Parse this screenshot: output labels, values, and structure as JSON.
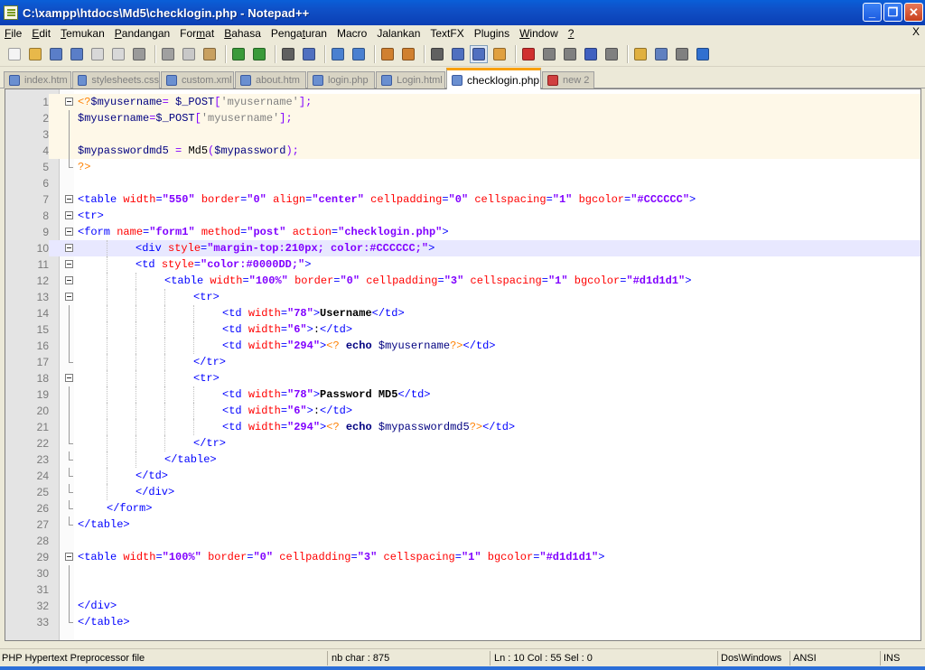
{
  "window": {
    "title": "C:\\xampp\\htdocs\\Md5\\checklogin.php - Notepad++"
  },
  "menu": [
    {
      "label": "File",
      "key": "F"
    },
    {
      "label": "Edit",
      "key": "E"
    },
    {
      "label": "Temukan",
      "key": "T"
    },
    {
      "label": "Pandangan",
      "key": "P"
    },
    {
      "label": "Format",
      "key": "m"
    },
    {
      "label": "Bahasa",
      "key": "B"
    },
    {
      "label": "Pengaturan",
      "key": "t"
    },
    {
      "label": "Macro",
      "key": ""
    },
    {
      "label": "Jalankan",
      "key": ""
    },
    {
      "label": "TextFX",
      "key": ""
    },
    {
      "label": "Plugins",
      "key": ""
    },
    {
      "label": "Window",
      "key": "W"
    },
    {
      "label": "?",
      "key": "?"
    }
  ],
  "menu_close": "X",
  "toolbar": [
    {
      "icon": "new-file-icon",
      "color": "#f4f4f4"
    },
    {
      "icon": "open-file-icon",
      "color": "#e8b84a"
    },
    {
      "icon": "save-icon",
      "color": "#5a7ec8"
    },
    {
      "icon": "save-all-icon",
      "color": "#5a7ec8"
    },
    {
      "icon": "close-file-icon",
      "color": "#d8d8d8"
    },
    {
      "icon": "close-all-icon",
      "color": "#d8d8d8"
    },
    {
      "icon": "print-icon",
      "color": "#9a9a9a"
    },
    {
      "sep": true
    },
    {
      "icon": "cut-icon",
      "color": "#a0a0a0"
    },
    {
      "icon": "copy-icon",
      "color": "#c8c8c8"
    },
    {
      "icon": "paste-icon",
      "color": "#c8a060"
    },
    {
      "sep": true
    },
    {
      "icon": "undo-icon",
      "color": "#3a9a3a"
    },
    {
      "icon": "redo-icon",
      "color": "#3a9a3a"
    },
    {
      "sep": true
    },
    {
      "icon": "find-icon",
      "color": "#606060"
    },
    {
      "icon": "replace-icon",
      "color": "#5070c0"
    },
    {
      "sep": true
    },
    {
      "icon": "zoom-in-icon",
      "color": "#4a80d0"
    },
    {
      "icon": "zoom-out-icon",
      "color": "#4a80d0"
    },
    {
      "sep": true
    },
    {
      "icon": "sync-vertical-icon",
      "color": "#d08030"
    },
    {
      "icon": "sync-horizontal-icon",
      "color": "#d08030"
    },
    {
      "sep": true
    },
    {
      "icon": "word-wrap-icon",
      "color": "#606060"
    },
    {
      "icon": "show-all-chars-icon",
      "color": "#5070c0"
    },
    {
      "icon": "indent-guide-icon",
      "color": "#5070c0",
      "active": true
    },
    {
      "icon": "user-language-icon",
      "color": "#e0a040"
    },
    {
      "sep": true
    },
    {
      "icon": "record-macro-icon",
      "color": "#d03030"
    },
    {
      "icon": "stop-macro-icon",
      "color": "#808080"
    },
    {
      "icon": "play-macro-icon",
      "color": "#808080"
    },
    {
      "icon": "run-macro-multiple-icon",
      "color": "#4060c0"
    },
    {
      "icon": "save-macro-icon",
      "color": "#808080"
    },
    {
      "sep": true
    },
    {
      "icon": "folder-icon",
      "color": "#e0b040"
    },
    {
      "icon": "window-icon",
      "color": "#6080c0"
    },
    {
      "icon": "print-preview-icon",
      "color": "#808080"
    },
    {
      "icon": "spellcheck-icon",
      "color": "#3070d0"
    }
  ],
  "tabs": [
    {
      "label": "index.htm",
      "active": false,
      "unsaved": false
    },
    {
      "label": "stylesheets.css",
      "active": false,
      "unsaved": false
    },
    {
      "label": "custom.xml",
      "active": false,
      "unsaved": false
    },
    {
      "label": "about.htm",
      "active": false,
      "unsaved": false
    },
    {
      "label": "login.php",
      "active": false,
      "unsaved": false
    },
    {
      "label": "Login.html",
      "active": false,
      "unsaved": false
    },
    {
      "label": "checklogin.php",
      "active": true,
      "unsaved": false
    },
    {
      "label": "new 2",
      "active": false,
      "unsaved": true
    }
  ],
  "current_line": 10,
  "code": [
    {
      "n": "1",
      "fold": "box",
      "php": true,
      "indent": 0,
      "tokens": [
        [
          "php",
          "<?"
        ],
        [
          "var",
          "$myusername"
        ],
        [
          "op",
          "= "
        ],
        [
          "var",
          "$_POST"
        ],
        [
          "op",
          "["
        ],
        [
          "str",
          "'myusername'"
        ],
        [
          "op",
          "];"
        ]
      ]
    },
    {
      "n": "2",
      "fold": "line",
      "php": true,
      "indent": 0,
      "tokens": [
        [
          "var",
          "$myusername"
        ],
        [
          "op",
          "="
        ],
        [
          "var",
          "$_POST"
        ],
        [
          "op",
          "["
        ],
        [
          "str",
          "'myusername'"
        ],
        [
          "op",
          "];"
        ]
      ]
    },
    {
      "n": "3",
      "fold": "line",
      "php": true,
      "indent": 0,
      "tokens": []
    },
    {
      "n": "4",
      "fold": "line",
      "php": true,
      "indent": 0,
      "tokens": [
        [
          "var",
          "$mypasswordmd5"
        ],
        [
          "op",
          " = "
        ],
        [
          "fn",
          "Md5"
        ],
        [
          "op",
          "("
        ],
        [
          "var",
          "$mypassword"
        ],
        [
          "op",
          ");"
        ]
      ]
    },
    {
      "n": "5",
      "fold": "end",
      "php": false,
      "indent": 0,
      "tokens": [
        [
          "php",
          "?>"
        ]
      ]
    },
    {
      "n": "6",
      "fold": "",
      "php": false,
      "indent": 0,
      "tokens": []
    },
    {
      "n": "7",
      "fold": "box",
      "php": false,
      "indent": 0,
      "tokens": [
        [
          "tag",
          "<table "
        ],
        [
          "attr",
          "width"
        ],
        [
          "tag",
          "="
        ],
        [
          "val",
          "\"550\""
        ],
        [
          "tag",
          " "
        ],
        [
          "attr",
          "border"
        ],
        [
          "tag",
          "="
        ],
        [
          "val",
          "\"0\""
        ],
        [
          "tag",
          " "
        ],
        [
          "attr",
          "align"
        ],
        [
          "tag",
          "="
        ],
        [
          "val",
          "\"center\""
        ],
        [
          "tag",
          " "
        ],
        [
          "attr",
          "cellpadding"
        ],
        [
          "tag",
          "="
        ],
        [
          "val",
          "\"0\""
        ],
        [
          "tag",
          " "
        ],
        [
          "attr",
          "cellspacing"
        ],
        [
          "tag",
          "="
        ],
        [
          "val",
          "\"1\""
        ],
        [
          "tag",
          " "
        ],
        [
          "attr",
          "bgcolor"
        ],
        [
          "tag",
          "="
        ],
        [
          "val",
          "\"#CCCCCC\""
        ],
        [
          "tag",
          ">"
        ]
      ]
    },
    {
      "n": "8",
      "fold": "box",
      "php": false,
      "indent": 0,
      "tokens": [
        [
          "tag",
          "<tr>"
        ]
      ]
    },
    {
      "n": "9",
      "fold": "box",
      "php": false,
      "indent": 0,
      "tokens": [
        [
          "tag",
          "<form "
        ],
        [
          "attr",
          "name"
        ],
        [
          "tag",
          "="
        ],
        [
          "val",
          "\"form1\""
        ],
        [
          "tag",
          " "
        ],
        [
          "attr",
          "method"
        ],
        [
          "tag",
          "="
        ],
        [
          "val",
          "\"post\""
        ],
        [
          "tag",
          " "
        ],
        [
          "attr",
          "action"
        ],
        [
          "tag",
          "="
        ],
        [
          "val",
          "\"checklogin.php\""
        ],
        [
          "tag",
          ">"
        ]
      ]
    },
    {
      "n": "10",
      "fold": "box",
      "php": false,
      "indent": 2,
      "tokens": [
        [
          "tag",
          "<div "
        ],
        [
          "attr",
          "style"
        ],
        [
          "tag",
          "="
        ],
        [
          "val",
          "\"margin-top:210px; color:#CCCCCC;\""
        ],
        [
          "tag",
          ">"
        ]
      ]
    },
    {
      "n": "11",
      "fold": "box",
      "php": false,
      "indent": 2,
      "tokens": [
        [
          "tag",
          "<td "
        ],
        [
          "attr",
          "style"
        ],
        [
          "tag",
          "="
        ],
        [
          "val",
          "\"color:#0000DD;\""
        ],
        [
          "tag",
          ">"
        ]
      ]
    },
    {
      "n": "12",
      "fold": "box",
      "php": false,
      "indent": 3,
      "tokens": [
        [
          "tag",
          "<table "
        ],
        [
          "attr",
          "width"
        ],
        [
          "tag",
          "="
        ],
        [
          "val",
          "\"100%\""
        ],
        [
          "tag",
          " "
        ],
        [
          "attr",
          "border"
        ],
        [
          "tag",
          "="
        ],
        [
          "val",
          "\"0\""
        ],
        [
          "tag",
          " "
        ],
        [
          "attr",
          "cellpadding"
        ],
        [
          "tag",
          "="
        ],
        [
          "val",
          "\"3\""
        ],
        [
          "tag",
          " "
        ],
        [
          "attr",
          "cellspacing"
        ],
        [
          "tag",
          "="
        ],
        [
          "val",
          "\"1\""
        ],
        [
          "tag",
          " "
        ],
        [
          "attr",
          "bgcolor"
        ],
        [
          "tag",
          "="
        ],
        [
          "val",
          "\"#d1d1d1\""
        ],
        [
          "tag",
          ">"
        ]
      ]
    },
    {
      "n": "13",
      "fold": "box",
      "php": false,
      "indent": 4,
      "tokens": [
        [
          "tag",
          "<tr>"
        ]
      ]
    },
    {
      "n": "14",
      "fold": "line",
      "php": false,
      "indent": 5,
      "tokens": [
        [
          "tag",
          "<td "
        ],
        [
          "attr",
          "width"
        ],
        [
          "tag",
          "="
        ],
        [
          "val",
          "\"78\""
        ],
        [
          "tag",
          ">"
        ],
        [
          "bold",
          "Username"
        ],
        [
          "tag",
          "</td>"
        ]
      ]
    },
    {
      "n": "15",
      "fold": "line",
      "php": false,
      "indent": 5,
      "tokens": [
        [
          "tag",
          "<td "
        ],
        [
          "attr",
          "width"
        ],
        [
          "tag",
          "="
        ],
        [
          "val",
          "\"6\""
        ],
        [
          "tag",
          ">"
        ],
        [
          "plain",
          ":"
        ],
        [
          "tag",
          "</td>"
        ]
      ]
    },
    {
      "n": "16",
      "fold": "line",
      "php": false,
      "indent": 5,
      "tokens": [
        [
          "tag",
          "<td "
        ],
        [
          "attr",
          "width"
        ],
        [
          "tag",
          "="
        ],
        [
          "val",
          "\"294\""
        ],
        [
          "tag",
          ">"
        ],
        [
          "php",
          "<?"
        ],
        [
          "plain",
          " "
        ],
        [
          "kw",
          "echo"
        ],
        [
          "plain",
          " "
        ],
        [
          "var",
          "$myusername"
        ],
        [
          "php",
          "?>"
        ],
        [
          "tag",
          "</td>"
        ]
      ]
    },
    {
      "n": "17",
      "fold": "end",
      "php": false,
      "indent": 4,
      "tokens": [
        [
          "tag",
          "</tr>"
        ]
      ]
    },
    {
      "n": "18",
      "fold": "box",
      "php": false,
      "indent": 4,
      "tokens": [
        [
          "tag",
          "<tr>"
        ]
      ]
    },
    {
      "n": "19",
      "fold": "line",
      "php": false,
      "indent": 5,
      "tokens": [
        [
          "tag",
          "<td "
        ],
        [
          "attr",
          "width"
        ],
        [
          "tag",
          "="
        ],
        [
          "val",
          "\"78\""
        ],
        [
          "tag",
          ">"
        ],
        [
          "bold",
          "Password MD5"
        ],
        [
          "tag",
          "</td>"
        ]
      ]
    },
    {
      "n": "20",
      "fold": "line",
      "php": false,
      "indent": 5,
      "tokens": [
        [
          "tag",
          "<td "
        ],
        [
          "attr",
          "width"
        ],
        [
          "tag",
          "="
        ],
        [
          "val",
          "\"6\""
        ],
        [
          "tag",
          ">"
        ],
        [
          "plain",
          ":"
        ],
        [
          "tag",
          "</td>"
        ]
      ]
    },
    {
      "n": "21",
      "fold": "line",
      "php": false,
      "indent": 5,
      "tokens": [
        [
          "tag",
          "<td "
        ],
        [
          "attr",
          "width"
        ],
        [
          "tag",
          "="
        ],
        [
          "val",
          "\"294\""
        ],
        [
          "tag",
          ">"
        ],
        [
          "php",
          "<?"
        ],
        [
          "plain",
          " "
        ],
        [
          "kw",
          "echo"
        ],
        [
          "plain",
          " "
        ],
        [
          "var",
          "$mypasswordmd5"
        ],
        [
          "php",
          "?>"
        ],
        [
          "tag",
          "</td>"
        ]
      ]
    },
    {
      "n": "22",
      "fold": "end",
      "php": false,
      "indent": 4,
      "tokens": [
        [
          "tag",
          "</tr>"
        ]
      ]
    },
    {
      "n": "23",
      "fold": "end",
      "php": false,
      "indent": 3,
      "tokens": [
        [
          "tag",
          "</table>"
        ]
      ]
    },
    {
      "n": "24",
      "fold": "end",
      "php": false,
      "indent": 2,
      "tokens": [
        [
          "tag",
          "</td>"
        ]
      ]
    },
    {
      "n": "25",
      "fold": "end",
      "php": false,
      "indent": 2,
      "tokens": [
        [
          "tag",
          "</div>"
        ]
      ]
    },
    {
      "n": "26",
      "fold": "end",
      "php": false,
      "indent": 1,
      "tokens": [
        [
          "tag",
          "</form>"
        ]
      ]
    },
    {
      "n": "27",
      "fold": "end",
      "php": false,
      "indent": 0,
      "tokens": [
        [
          "tag",
          "</table>"
        ]
      ]
    },
    {
      "n": "28",
      "fold": "",
      "php": false,
      "indent": 0,
      "tokens": []
    },
    {
      "n": "29",
      "fold": "box",
      "php": false,
      "indent": 0,
      "tokens": [
        [
          "tag",
          "<table "
        ],
        [
          "attr",
          "width"
        ],
        [
          "tag",
          "="
        ],
        [
          "val",
          "\"100%\""
        ],
        [
          "tag",
          " "
        ],
        [
          "attr",
          "border"
        ],
        [
          "tag",
          "="
        ],
        [
          "val",
          "\"0\""
        ],
        [
          "tag",
          " "
        ],
        [
          "attr",
          "cellpadding"
        ],
        [
          "tag",
          "="
        ],
        [
          "val",
          "\"3\""
        ],
        [
          "tag",
          " "
        ],
        [
          "attr",
          "cellspacing"
        ],
        [
          "tag",
          "="
        ],
        [
          "val",
          "\"1\""
        ],
        [
          "tag",
          " "
        ],
        [
          "attr",
          "bgcolor"
        ],
        [
          "tag",
          "="
        ],
        [
          "val",
          "\"#d1d1d1\""
        ],
        [
          "tag",
          ">"
        ]
      ]
    },
    {
      "n": "30",
      "fold": "line",
      "php": false,
      "indent": 0,
      "tokens": []
    },
    {
      "n": "31",
      "fold": "line",
      "php": false,
      "indent": 0,
      "tokens": []
    },
    {
      "n": "32",
      "fold": "line",
      "php": false,
      "indent": 0,
      "tokens": [
        [
          "tag",
          "</div>"
        ]
      ]
    },
    {
      "n": "33",
      "fold": "end",
      "php": false,
      "indent": 0,
      "tokens": [
        [
          "tag",
          "</table>"
        ]
      ]
    }
  ],
  "status": {
    "file_type": "PHP Hypertext Preprocessor file",
    "length": "nb char : 875",
    "position": "Ln : 10    Col : 55    Sel : 0",
    "eol": "Dos\\Windows",
    "encoding": "ANSI",
    "mode": "INS"
  }
}
